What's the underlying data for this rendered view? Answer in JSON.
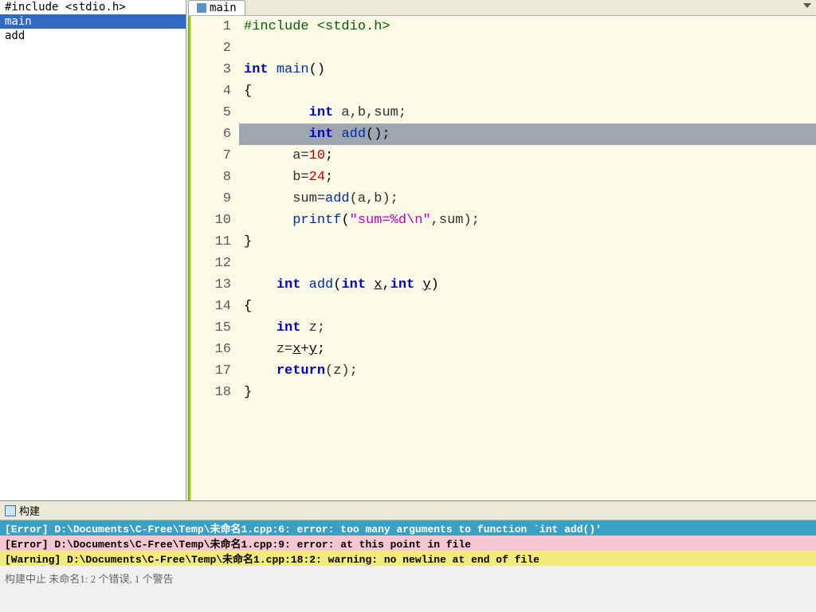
{
  "tab": {
    "label": "main"
  },
  "outline": {
    "items": [
      {
        "label": "#include <stdio.h>",
        "sel": false
      },
      {
        "label": "main",
        "sel": true
      },
      {
        "label": "add",
        "sel": false
      }
    ]
  },
  "editor": {
    "highlighted_line": 6,
    "lines": [
      {
        "n": 1,
        "tokens": [
          {
            "t": "#include <stdio.h>",
            "c": "pp"
          }
        ]
      },
      {
        "n": 2,
        "tokens": []
      },
      {
        "n": 3,
        "tokens": [
          {
            "t": "int",
            "c": "kw"
          },
          {
            "t": " "
          },
          {
            "t": "main",
            "c": "fn"
          },
          {
            "t": "()"
          }
        ]
      },
      {
        "n": 4,
        "tokens": [
          {
            "t": "{"
          }
        ]
      },
      {
        "n": 5,
        "tokens": [
          {
            "t": "        "
          },
          {
            "t": "int",
            "c": "kw"
          },
          {
            "t": " a,b,sum;",
            "c": "id"
          }
        ]
      },
      {
        "n": 6,
        "tokens": [
          {
            "t": "        "
          },
          {
            "t": "int",
            "c": "kw"
          },
          {
            "t": " "
          },
          {
            "t": "add",
            "c": "fn"
          },
          {
            "t": "();"
          }
        ]
      },
      {
        "n": 7,
        "tokens": [
          {
            "t": "      a=",
            "c": "id"
          },
          {
            "t": "10",
            "c": "num"
          },
          {
            "t": ";"
          }
        ]
      },
      {
        "n": 8,
        "tokens": [
          {
            "t": "      b=",
            "c": "id"
          },
          {
            "t": "24",
            "c": "num"
          },
          {
            "t": ";"
          }
        ]
      },
      {
        "n": 9,
        "tokens": [
          {
            "t": "      sum=",
            "c": "id"
          },
          {
            "t": "add",
            "c": "fn"
          },
          {
            "t": "(a,b);",
            "c": "id"
          }
        ]
      },
      {
        "n": 10,
        "tokens": [
          {
            "t": "      "
          },
          {
            "t": "printf",
            "c": "fn"
          },
          {
            "t": "("
          },
          {
            "t": "\"sum=%d\\n\"",
            "c": "str"
          },
          {
            "t": ",sum);",
            "c": "id"
          }
        ]
      },
      {
        "n": 11,
        "tokens": [
          {
            "t": "}"
          }
        ]
      },
      {
        "n": 12,
        "tokens": []
      },
      {
        "n": 13,
        "tokens": [
          {
            "t": "    "
          },
          {
            "t": "int",
            "c": "kw"
          },
          {
            "t": " "
          },
          {
            "t": "add",
            "c": "fn"
          },
          {
            "t": "("
          },
          {
            "t": "int",
            "c": "kw"
          },
          {
            "t": " "
          },
          {
            "t": "x",
            "u": true
          },
          {
            "t": ","
          },
          {
            "t": "int",
            "c": "kw"
          },
          {
            "t": " "
          },
          {
            "t": "y",
            "u": true
          },
          {
            "t": ")"
          }
        ]
      },
      {
        "n": 14,
        "tokens": [
          {
            "t": "{"
          }
        ]
      },
      {
        "n": 15,
        "tokens": [
          {
            "t": "    "
          },
          {
            "t": "int",
            "c": "kw"
          },
          {
            "t": " z;",
            "c": "id"
          }
        ]
      },
      {
        "n": 16,
        "tokens": [
          {
            "t": "    z=",
            "c": "id"
          },
          {
            "t": "x",
            "u": true
          },
          {
            "t": "+"
          },
          {
            "t": "y",
            "u": true
          },
          {
            "t": ";"
          }
        ]
      },
      {
        "n": 17,
        "tokens": [
          {
            "t": "    "
          },
          {
            "t": "return",
            "c": "kw"
          },
          {
            "t": "(z);",
            "c": "id"
          }
        ]
      },
      {
        "n": 18,
        "tokens": [
          {
            "t": "}"
          }
        ]
      }
    ]
  },
  "build": {
    "title": "构建",
    "messages": [
      {
        "style": "blue",
        "text": "[Error] D:\\Documents\\C-Free\\Temp\\未命名1.cpp:6: error: too many arguments to function `int add()'"
      },
      {
        "style": "pink",
        "text": "[Error] D:\\Documents\\C-Free\\Temp\\未命名1.cpp:9: error: at this point in file"
      },
      {
        "style": "yellow",
        "text": "[Warning] D:\\Documents\\C-Free\\Temp\\未命名1.cpp:18:2: warning: no newline at end of file"
      }
    ],
    "summary": "构建中止 未命名1: 2 个错误, 1 个警告"
  }
}
